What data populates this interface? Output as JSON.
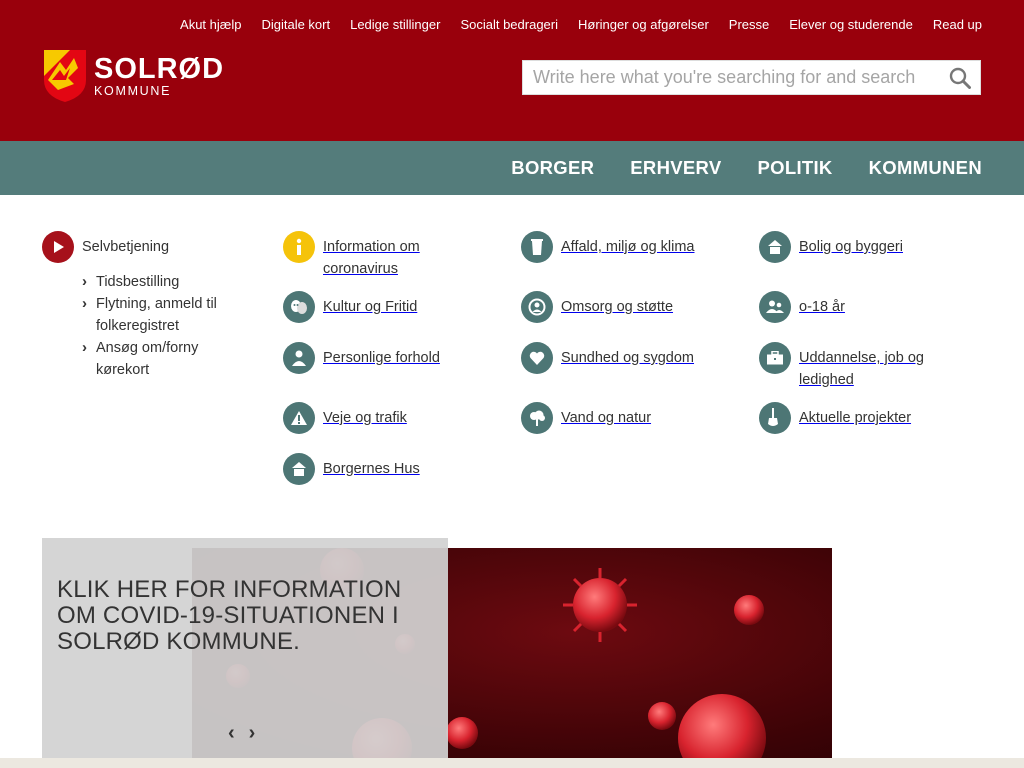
{
  "utility_nav": [
    "Akut hjælp",
    "Digitale kort",
    "Ledige stillinger",
    "Socialt bedrageri",
    "Høringer og afgørelser",
    "Presse",
    "Elever og studerende",
    "Read up"
  ],
  "logo": {
    "main": "SOLRØD",
    "sub": "KOMMUNE"
  },
  "search": {
    "placeholder": "Write here what you're searching for and search"
  },
  "main_nav": [
    "BORGER",
    "ERHVERV",
    "POLITIK",
    "KOMMUNEN"
  ],
  "selfservice": {
    "label": "Selvbetjening",
    "items": [
      "Tidsbestilling",
      "Flytning, anmeld til folkeregistret",
      "Ansøg om/forny kørekort"
    ]
  },
  "categories": [
    {
      "label": "Information om coronavirus",
      "icon": "info-icon"
    },
    {
      "label": "Affald, miljø og klima",
      "icon": "waste-bin-icon"
    },
    {
      "label": "Bolig og byggeri",
      "icon": "house-icon"
    },
    {
      "label": "Kultur og Fritid",
      "icon": "theater-masks-icon"
    },
    {
      "label": "Omsorg og støtte",
      "icon": "care-icon"
    },
    {
      "label": "o-18 år",
      "icon": "children-icon"
    },
    {
      "label": "Personlige forhold",
      "icon": "person-icon"
    },
    {
      "label": "Sundhed og sygdom",
      "icon": "heart-icon"
    },
    {
      "label": "Uddannelse, job og ledighed",
      "icon": "briefcase-icon"
    },
    {
      "label": "Veje og trafik",
      "icon": "road-icon"
    },
    {
      "label": "Vand og natur",
      "icon": "tree-icon"
    },
    {
      "label": "Aktuelle projekter",
      "icon": "shovel-icon"
    },
    {
      "label": "Borgernes Hus",
      "icon": "house-icon"
    }
  ],
  "hero": {
    "title": "KLIK HER FOR INFORMATION OM COVID-19-SITUATIONEN I SOLRØD KOMMUNE.",
    "prev": "‹",
    "next": "›"
  },
  "colors": {
    "header": "#99000c",
    "nav": "#547c7b",
    "icon_teal": "#4d7675",
    "icon_red": "#a6111b",
    "icon_yellow": "#f5c30a"
  }
}
